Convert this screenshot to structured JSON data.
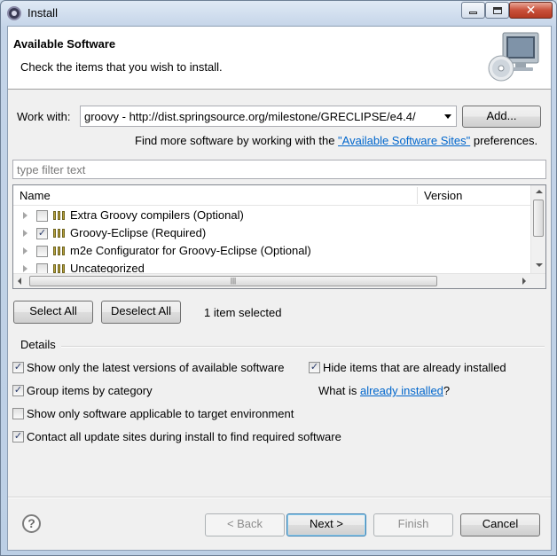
{
  "window": {
    "title": "Install"
  },
  "banner": {
    "title": "Available Software",
    "subtitle": "Check the items that you wish to install."
  },
  "work_with": {
    "label": "Work with:",
    "value": "groovy - http://dist.springsource.org/milestone/GRECLIPSE/e4.4/",
    "add_button": "Add..."
  },
  "more_software": {
    "prefix": "Find more software by working with the ",
    "link": "\"Available Software Sites\"",
    "suffix": " preferences."
  },
  "filter": {
    "placeholder": "type filter text"
  },
  "tree": {
    "columns": {
      "name": "Name",
      "version": "Version"
    },
    "items": [
      {
        "label": "Extra Groovy compilers (Optional)",
        "checked": false
      },
      {
        "label": "Groovy-Eclipse (Required)",
        "checked": true
      },
      {
        "label": "m2e Configurator for Groovy-Eclipse (Optional)",
        "checked": false
      },
      {
        "label": "Uncategorized",
        "checked": false
      }
    ]
  },
  "selection": {
    "select_all": "Select All",
    "deselect_all": "Deselect All",
    "status": "1 item selected"
  },
  "details": {
    "label": "Details",
    "options": {
      "latest_versions": {
        "label": "Show only the latest versions of available software",
        "checked": true
      },
      "hide_installed": {
        "label": "Hide items that are already installed",
        "checked": true
      },
      "group_by_category": {
        "label": "Group items by category",
        "checked": true
      },
      "applicable_only": {
        "label": "Show only software applicable to target environment",
        "checked": false
      },
      "contact_all_sites": {
        "label": "Contact all update sites during install to find required software",
        "checked": true
      }
    },
    "what_is": {
      "prefix": "What is ",
      "link": "already installed",
      "suffix": "?"
    }
  },
  "footer": {
    "help": "?",
    "back": "< Back",
    "next": "Next >",
    "finish": "Finish",
    "cancel": "Cancel"
  }
}
